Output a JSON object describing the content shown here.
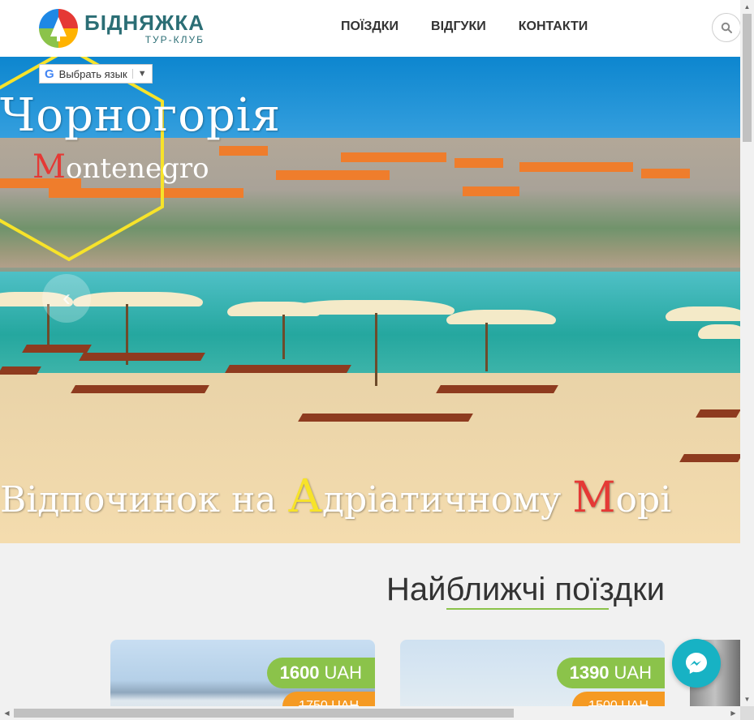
{
  "header": {
    "logo_title": "БІДНЯЖКА",
    "logo_subtitle": "ТУР-КЛУБ",
    "nav": [
      "ПОЇЗДКИ",
      "ВІДГУКИ",
      "КОНТАКТИ"
    ],
    "search_icon": "search-icon"
  },
  "hero": {
    "language_selector": "Выбрать язык",
    "title": "Чорногорія",
    "subtitle_first": "M",
    "subtitle_rest": "ontenegro",
    "tagline_part1": "Відпочинок на ",
    "tagline_accent1": "А",
    "tagline_part2": "дріатичному ",
    "tagline_accent2": "М",
    "tagline_part3": "орі",
    "prev_icon": "chevron-left-icon"
  },
  "section": {
    "title": "Найближчі поїздки"
  },
  "trips": [
    {
      "price_value": "1600",
      "currency": "UAH",
      "old_price": "1750 UAH"
    },
    {
      "price_value": "1390",
      "currency": "UAH",
      "old_price": "1500 UAH"
    }
  ],
  "colors": {
    "accent_green": "#8bc34a",
    "accent_orange": "#f59a23",
    "brand_teal": "#2b6e75",
    "messenger": "#17b2c4"
  }
}
